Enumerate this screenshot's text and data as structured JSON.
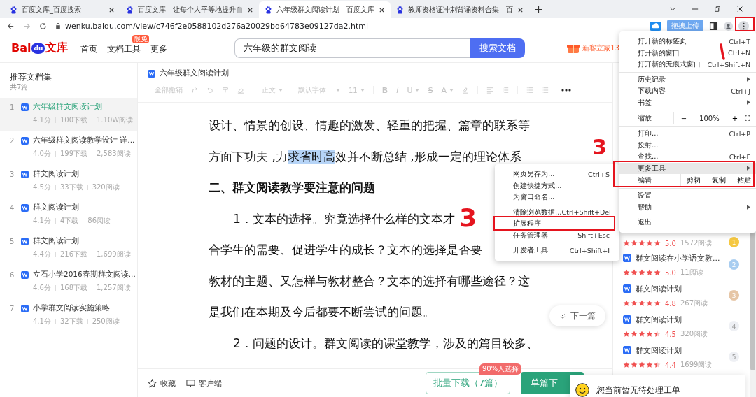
{
  "tabs": [
    {
      "title": "百度文库_百度搜索",
      "selected": false
    },
    {
      "title": "百度文库 - 让每个人平等地提升自",
      "selected": false
    },
    {
      "title": "六年级群文阅读计划 - 百度文库",
      "selected": true
    },
    {
      "title": "教师资格证冲刺背诵资料合集 - 百",
      "selected": false
    }
  ],
  "address_bar": {
    "url": "wenku.baidu.com/view/c746f2e0588102d276a20029bd64783e09127da2.html"
  },
  "extension": {
    "label": "拖拽上传"
  },
  "site_header": {
    "logo": {
      "prefix": "Bai",
      "mark": "du",
      "suffix": "文库"
    },
    "nav": [
      {
        "label": "首页"
      },
      {
        "label": "文档工具",
        "badge": "限免"
      },
      {
        "label": "更多"
      }
    ],
    "search": {
      "value": "六年级的群文阅读",
      "button": "搜索文档"
    },
    "promo": "新客立减13"
  },
  "sidebar": {
    "title": "推荐文档集",
    "count": "共7篇",
    "items": [
      {
        "number": "1",
        "title": "六年级群文阅读计划",
        "score": "4.1分",
        "downloads": "100下载",
        "reads": "1.10W阅读",
        "selected": true
      },
      {
        "number": "2",
        "title": "六年级群文阅读教学设计 详...",
        "score": "4.0分",
        "downloads": "199下载",
        "reads": "2,583阅读",
        "selected": false
      },
      {
        "number": "3",
        "title": "群文阅读计划",
        "score": "4.5分",
        "downloads": "33下载",
        "reads": "320阅读",
        "selected": false
      },
      {
        "number": "4",
        "title": "群文阅读计划",
        "score": "4.1分",
        "downloads": "4下载",
        "reads": "86阅读",
        "selected": false
      },
      {
        "number": "5",
        "title": "群文阅读计划",
        "score": "4.4分",
        "downloads": "216下载",
        "reads": "1,699阅读",
        "selected": false
      },
      {
        "number": "6",
        "title": "立石小学2016春期群文阅读...",
        "score": "4.6分",
        "downloads": "168下载",
        "reads": "1,257阅读",
        "selected": false
      },
      {
        "number": "7",
        "title": "小学群文阅读实施策略",
        "score": "4.1分",
        "downloads": "32下载",
        "reads": "250阅读",
        "selected": false
      }
    ]
  },
  "document": {
    "title": "六年级群文阅读计划",
    "toolbar": {
      "undo_all": "全部撤销",
      "style": "正文",
      "font": "默认字体",
      "size": "11",
      "letters": [
        "B",
        "I",
        "U",
        "S",
        "A"
      ]
    },
    "lines": [
      {
        "kind": "line",
        "segments": [
          {
            "text": "设计、情景的创设、情趣的激发、轻重的把握、篇章的联系等",
            "selected": false
          }
        ]
      },
      {
        "kind": "line",
        "segments": [
          {
            "text": "方面下功夫 ,力",
            "selected": false
          },
          {
            "text": "求省时高",
            "selected": true
          },
          {
            "text": "效并不断总结 ,形成一定的理论体系",
            "selected": false
          }
        ]
      },
      {
        "kind": "heading",
        "segments": [
          {
            "text": "二、群文阅读教学要注意的问题",
            "selected": false
          }
        ]
      },
      {
        "kind": "indent",
        "segments": [
          {
            "text": "1．文本的选择。究竟选择什么样的文本才",
            "selected": false
          }
        ]
      },
      {
        "kind": "line",
        "segments": [
          {
            "text": "合学生的需要、促进学生的成长？文本的选择是否要",
            "selected": false
          }
        ]
      },
      {
        "kind": "line",
        "segments": [
          {
            "text": "教材的主题、又怎样与教材整合？文本的选择有哪些途径？这",
            "selected": false
          }
        ]
      },
      {
        "kind": "line",
        "segments": [
          {
            "text": "是我们在本期及今后都要不断尝试的问题。",
            "selected": false
          }
        ]
      },
      {
        "kind": "indent",
        "segments": [
          {
            "text": "2．问题的设计。群文阅读的课堂教学，涉及的篇目较多、",
            "selected": false
          }
        ]
      }
    ],
    "next_button": "下一篇"
  },
  "bottom_bar": {
    "favorite": "收藏",
    "client": "客户端",
    "batch_download": "批量下载（7篇）",
    "batch_badge": "90%人选择",
    "single_download": "单篇下"
  },
  "toast": "您当前暂无待处理工单",
  "related": [
    {
      "stars": 5,
      "rating": "5.0",
      "reads": "1572阅读",
      "rank": "1",
      "color": "#f5c842"
    },
    {
      "title": "群文阅读在小学语文教...",
      "stars": 5,
      "rating": "5.0",
      "reads": "11阅读",
      "rank": "2",
      "color": "#a8cdf0"
    },
    {
      "title": "群文阅读计划",
      "stars": 5,
      "rating": "4.8",
      "reads": "267阅读",
      "rank": "3",
      "color": "#e6c6a6"
    },
    {
      "title": "群文阅读计划",
      "stars": 4.5,
      "rating": "4.5",
      "reads": "320阅读",
      "rank": "4",
      "color": "#eef0f4"
    },
    {
      "title": "群文阅读计划",
      "stars": 4.5,
      "rating": "4.4",
      "reads": "1699阅读",
      "rank": "5",
      "color": "#eef0f4"
    }
  ],
  "browser_menu": {
    "groups": [
      [
        {
          "kind": "item",
          "label": "打开新的标签页",
          "shortcut": "Ctrl+T",
          "submenu": false,
          "selected": false
        },
        {
          "kind": "item",
          "label": "打开新的窗口",
          "shortcut": "Ctrl+N",
          "submenu": false,
          "selected": false
        },
        {
          "kind": "item",
          "label": "打开新的无痕式窗口",
          "shortcut": "Ctrl+Shift+N",
          "submenu": false,
          "selected": false
        }
      ],
      [
        {
          "kind": "item",
          "label": "历史记录",
          "submenu": true,
          "selected": false
        },
        {
          "kind": "item",
          "label": "下载内容",
          "shortcut": "Ctrl+J",
          "submenu": false,
          "selected": false
        },
        {
          "kind": "item",
          "label": "书签",
          "submenu": true,
          "selected": false
        }
      ],
      [
        {
          "kind": "zoom",
          "label": "缩放",
          "minus": "−",
          "value": "100%",
          "plus": "+"
        }
      ],
      [
        {
          "kind": "item",
          "label": "打印...",
          "shortcut": "Ctrl+P",
          "submenu": false,
          "selected": false
        },
        {
          "kind": "item",
          "label": "投射...",
          "submenu": false,
          "selected": false
        },
        {
          "kind": "item",
          "label": "查找...",
          "shortcut": "Ctrl+F",
          "submenu": false,
          "selected": false
        },
        {
          "kind": "item",
          "label": "更多工具",
          "submenu": true,
          "selected": true
        },
        {
          "kind": "edit",
          "label": "编辑",
          "actions": [
            "剪切",
            "复制",
            "粘贴"
          ]
        }
      ],
      [
        {
          "kind": "item",
          "label": "设置",
          "submenu": false,
          "selected": false
        },
        {
          "kind": "item",
          "label": "帮助",
          "submenu": true,
          "selected": false
        }
      ],
      [
        {
          "kind": "item",
          "label": "退出",
          "submenu": false,
          "selected": false
        }
      ]
    ]
  },
  "more_tools_menu": {
    "groups": [
      [
        {
          "label": "网页另存为...",
          "shortcut": "Ctrl+S"
        },
        {
          "label": "创建快捷方式..."
        },
        {
          "label": "为窗口命名..."
        }
      ],
      [
        {
          "label": "清除浏览数据...",
          "shortcut": "Ctrl+Shift+Del"
        },
        {
          "label": "扩展程序"
        },
        {
          "label": "任务管理器",
          "shortcut": "Shift+Esc"
        }
      ],
      [
        {
          "label": "开发者工具",
          "shortcut": "Ctrl+Shift+I"
        }
      ]
    ]
  },
  "annotations": [
    {
      "kind": "box"
    },
    {
      "kind": "box"
    },
    {
      "kind": "box"
    },
    {
      "kind": "stroke"
    },
    {
      "kind": "numeral",
      "label": "3"
    },
    {
      "kind": "numeral",
      "label": "3"
    }
  ]
}
